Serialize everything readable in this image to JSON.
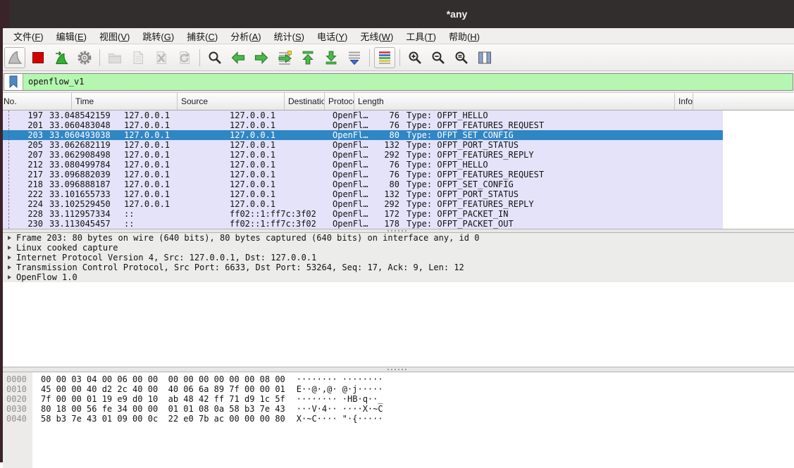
{
  "window": {
    "title": "*any"
  },
  "colors": {
    "titlebar_bg": "#322e2e",
    "window_border": "#3a2329",
    "menu_bg": "#f0efee",
    "filter_bg": "#b5f7b1",
    "row_bg": "#e4e3f9",
    "selected_row": "#2f86c5",
    "detail_row_bg": "#ececeb"
  },
  "menu_bar": {
    "items": [
      {
        "name": "menu-item-file",
        "pre": "文件(",
        "key": "F",
        "post": ")"
      },
      {
        "name": "menu-item-edit",
        "pre": "编辑(",
        "key": "E",
        "post": ")"
      },
      {
        "name": "menu-item-view",
        "pre": "视图(",
        "key": "V",
        "post": ")"
      },
      {
        "name": "menu-item-go",
        "pre": "跳转(",
        "key": "G",
        "post": ")"
      },
      {
        "name": "menu-item-capture",
        "pre": "捕获(",
        "key": "C",
        "post": ")"
      },
      {
        "name": "menu-item-analyze",
        "pre": "分析(",
        "key": "A",
        "post": ")"
      },
      {
        "name": "menu-item-statistics",
        "pre": "统计(",
        "key": "S",
        "post": ")"
      },
      {
        "name": "menu-item-telephony",
        "pre": "电话(",
        "key": "Y",
        "post": ")"
      },
      {
        "name": "menu-item-wireless",
        "pre": "无线(",
        "key": "W",
        "post": ")"
      },
      {
        "name": "menu-item-tools",
        "pre": "工具(",
        "key": "T",
        "post": ")"
      },
      {
        "name": "menu-item-help",
        "pre": "帮助(",
        "key": "H",
        "post": ")"
      }
    ]
  },
  "toolbar": {
    "group1": [
      {
        "name": "start-capture-button",
        "icon": "wireshark-fin-icon",
        "framed": true
      },
      {
        "name": "stop-capture-button",
        "icon": "stop-icon"
      },
      {
        "name": "restart-capture-button",
        "icon": "restart-icon"
      },
      {
        "name": "capture-options-button",
        "icon": "capture-options-icon"
      }
    ],
    "group2": [
      {
        "name": "open-file-button",
        "icon": "open-folder-icon",
        "disabled": true
      },
      {
        "name": "save-file-button",
        "icon": "save-file-icon",
        "disabled": true
      },
      {
        "name": "close-file-button",
        "icon": "close-file-icon",
        "disabled": true
      },
      {
        "name": "reload-file-button",
        "icon": "reload-file-icon",
        "disabled": true
      }
    ],
    "group3": [
      {
        "name": "find-packet-button",
        "icon": "find-icon"
      },
      {
        "name": "go-back-button",
        "icon": "back-arrow-icon"
      },
      {
        "name": "go-forward-button",
        "icon": "forward-arrow-icon"
      },
      {
        "name": "go-to-packet-button",
        "icon": "goto-packet-icon"
      },
      {
        "name": "go-to-top-button",
        "icon": "go-top-icon"
      },
      {
        "name": "go-to-bottom-button",
        "icon": "go-bottom-icon"
      },
      {
        "name": "auto-scroll-button",
        "icon": "auto-scroll-icon"
      }
    ],
    "group4": [
      {
        "name": "colorize-button",
        "icon": "colorize-icon",
        "framed": true
      }
    ],
    "group5": [
      {
        "name": "zoom-in-button",
        "icon": "zoom-in-icon"
      },
      {
        "name": "zoom-out-button",
        "icon": "zoom-out-icon"
      },
      {
        "name": "zoom-reset-button",
        "icon": "zoom-reset-icon"
      },
      {
        "name": "resize-columns-button",
        "icon": "resize-columns-icon"
      }
    ]
  },
  "filter": {
    "value": "openflow_v1"
  },
  "packet_list": {
    "columns": [
      {
        "name": "column-header-no",
        "label": "No."
      },
      {
        "name": "column-header-time",
        "label": "Time"
      },
      {
        "name": "column-header-source",
        "label": "Source"
      },
      {
        "name": "column-header-destination",
        "label": "Destination"
      },
      {
        "name": "column-header-protocol",
        "label": "Protocol"
      },
      {
        "name": "column-header-length",
        "label": "Length"
      },
      {
        "name": "column-header-info",
        "label": "Info"
      }
    ],
    "rows": [
      {
        "no": "197",
        "time": "33.048542159",
        "source": "127.0.0.1",
        "destination": "127.0.0.1",
        "protocol": "OpenFl…",
        "length": "76",
        "info": "Type: OFPT_HELLO"
      },
      {
        "no": "201",
        "time": "33.060483048",
        "source": "127.0.0.1",
        "destination": "127.0.0.1",
        "protocol": "OpenFl…",
        "length": "76",
        "info": "Type: OFPT_FEATURES_REQUEST"
      },
      {
        "no": "203",
        "time": "33.060493038",
        "source": "127.0.0.1",
        "destination": "127.0.0.1",
        "protocol": "OpenFl…",
        "length": "80",
        "info": "Type: OFPT_SET_CONFIG",
        "selected": true
      },
      {
        "no": "205",
        "time": "33.062682119",
        "source": "127.0.0.1",
        "destination": "127.0.0.1",
        "protocol": "OpenFl…",
        "length": "132",
        "info": "Type: OFPT_PORT_STATUS"
      },
      {
        "no": "207",
        "time": "33.062908498",
        "source": "127.0.0.1",
        "destination": "127.0.0.1",
        "protocol": "OpenFl…",
        "length": "292",
        "info": "Type: OFPT_FEATURES_REPLY"
      },
      {
        "no": "212",
        "time": "33.080499784",
        "source": "127.0.0.1",
        "destination": "127.0.0.1",
        "protocol": "OpenFl…",
        "length": "76",
        "info": "Type: OFPT_HELLO"
      },
      {
        "no": "217",
        "time": "33.096882039",
        "source": "127.0.0.1",
        "destination": "127.0.0.1",
        "protocol": "OpenFl…",
        "length": "76",
        "info": "Type: OFPT_FEATURES_REQUEST"
      },
      {
        "no": "218",
        "time": "33.096888187",
        "source": "127.0.0.1",
        "destination": "127.0.0.1",
        "protocol": "OpenFl…",
        "length": "80",
        "info": "Type: OFPT_SET_CONFIG"
      },
      {
        "no": "222",
        "time": "33.101655733",
        "source": "127.0.0.1",
        "destination": "127.0.0.1",
        "protocol": "OpenFl…",
        "length": "132",
        "info": "Type: OFPT_PORT_STATUS"
      },
      {
        "no": "224",
        "time": "33.102529450",
        "source": "127.0.0.1",
        "destination": "127.0.0.1",
        "protocol": "OpenFl…",
        "length": "292",
        "info": "Type: OFPT_FEATURES_REPLY"
      },
      {
        "no": "228",
        "time": "33.112957334",
        "source": "::",
        "destination": "ff02::1:ff7c:3f02",
        "protocol": "OpenFl…",
        "length": "172",
        "info": "Type: OFPT_PACKET_IN"
      },
      {
        "no": "230",
        "time": "33.113045457",
        "source": "::",
        "destination": "ff02::1:ff7c:3f02",
        "protocol": "OpenFl…",
        "length": "178",
        "info": "Type: OFPT_PACKET_OUT"
      }
    ]
  },
  "details": {
    "rows": [
      {
        "text": "Frame 203: 80 bytes on wire (640 bits), 80 bytes captured (640 bits) on interface any, id 0"
      },
      {
        "text": "Linux cooked capture"
      },
      {
        "text": "Internet Protocol Version 4, Src: 127.0.0.1, Dst: 127.0.0.1"
      },
      {
        "text": "Transmission Control Protocol, Src Port: 6633, Dst Port: 53264, Seq: 17, Ack: 9, Len: 12"
      },
      {
        "text": "OpenFlow 1.0"
      }
    ]
  },
  "hex_dump": {
    "rows": [
      {
        "offset": "0000",
        "hex": "00 00 03 04 00 06 00 00  00 00 00 00 00 00 08 00",
        "ascii": "········ ········"
      },
      {
        "offset": "0010",
        "hex": "45 00 00 40 d2 2c 40 00  40 06 6a 89 7f 00 00 01",
        "ascii": "E··@·,@· @·j·····"
      },
      {
        "offset": "0020",
        "hex": "7f 00 00 01 19 e9 d0 10  ab 48 42 ff 71 d9 1c 5f",
        "ascii": "········ ·HB·q··_"
      },
      {
        "offset": "0030",
        "hex": "80 18 00 56 fe 34 00 00  01 01 08 0a 58 b3 7e 43",
        "ascii": "···V·4·· ····X·~C"
      },
      {
        "offset": "0040",
        "hex": "58 b3 7e 43 01 09 00 0c  22 e0 7b ac 00 00 00 80",
        "ascii": "X·~C···· \"·{·····"
      }
    ]
  }
}
